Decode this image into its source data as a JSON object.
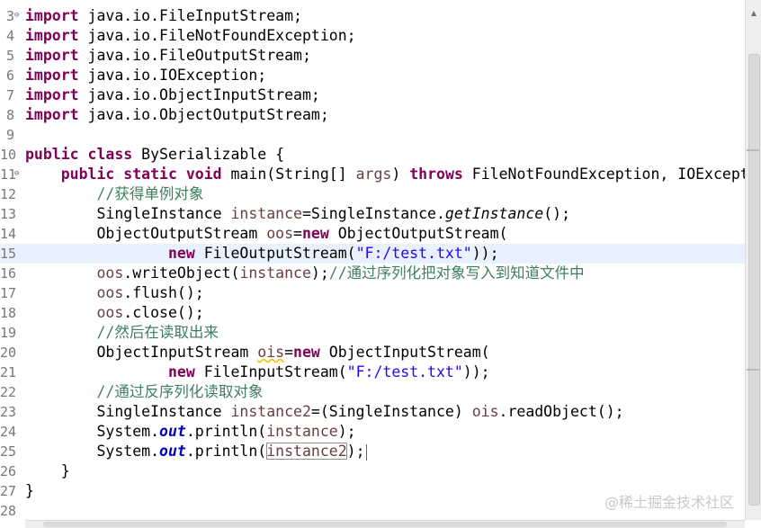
{
  "lines": [
    {
      "num": "3",
      "fold": "⊖",
      "current": false,
      "tokens": [
        {
          "t": "import",
          "c": "kw"
        },
        {
          "t": " java.io.FileInputStream;"
        }
      ]
    },
    {
      "num": "4",
      "fold": "",
      "current": false,
      "tokens": [
        {
          "t": "import",
          "c": "kw"
        },
        {
          "t": " java.io.FileNotFoundException;"
        }
      ]
    },
    {
      "num": "5",
      "fold": "",
      "current": false,
      "tokens": [
        {
          "t": "import",
          "c": "kw"
        },
        {
          "t": " java.io.FileOutputStream;"
        }
      ]
    },
    {
      "num": "6",
      "fold": "",
      "current": false,
      "tokens": [
        {
          "t": "import",
          "c": "kw"
        },
        {
          "t": " java.io.IOException;"
        }
      ]
    },
    {
      "num": "7",
      "fold": "",
      "current": false,
      "tokens": [
        {
          "t": "import",
          "c": "kw"
        },
        {
          "t": " java.io.ObjectInputStream;"
        }
      ]
    },
    {
      "num": "8",
      "fold": "",
      "current": false,
      "tokens": [
        {
          "t": "import",
          "c": "kw"
        },
        {
          "t": " java.io.ObjectOutputStream;"
        }
      ]
    },
    {
      "num": "9",
      "fold": "",
      "current": false,
      "tokens": []
    },
    {
      "num": "10",
      "fold": "",
      "current": false,
      "tokens": [
        {
          "t": "public",
          "c": "kw"
        },
        {
          "t": " "
        },
        {
          "t": "class",
          "c": "kw"
        },
        {
          "t": " BySerializable {"
        }
      ]
    },
    {
      "num": "11",
      "fold": "⊖",
      "current": false,
      "tokens": [
        {
          "t": "    "
        },
        {
          "t": "public",
          "c": "kw"
        },
        {
          "t": " "
        },
        {
          "t": "static",
          "c": "kw"
        },
        {
          "t": " "
        },
        {
          "t": "void",
          "c": "kw"
        },
        {
          "t": " main(String[] "
        },
        {
          "t": "args",
          "c": "arg"
        },
        {
          "t": ") "
        },
        {
          "t": "throws",
          "c": "kw"
        },
        {
          "t": " FileNotFoundException, IOException {"
        }
      ]
    },
    {
      "num": "12",
      "fold": "",
      "current": false,
      "tokens": [
        {
          "t": "        "
        },
        {
          "t": "//获得单例对象",
          "c": "cm"
        }
      ]
    },
    {
      "num": "13",
      "fold": "",
      "current": false,
      "tokens": [
        {
          "t": "        SingleInstance "
        },
        {
          "t": "instance",
          "c": "arg"
        },
        {
          "t": "=SingleInstance."
        },
        {
          "t": "getInstance",
          "c": "smeth"
        },
        {
          "t": "();"
        }
      ]
    },
    {
      "num": "14",
      "fold": "",
      "current": false,
      "tokens": [
        {
          "t": "        ObjectOutputStream "
        },
        {
          "t": "oos",
          "c": "arg"
        },
        {
          "t": "="
        },
        {
          "t": "new",
          "c": "kw"
        },
        {
          "t": " ObjectOutputStream("
        }
      ]
    },
    {
      "num": "15",
      "fold": "",
      "current": true,
      "tokens": [
        {
          "t": "                "
        },
        {
          "t": "new",
          "c": "kw"
        },
        {
          "t": " FileOutputStream("
        },
        {
          "t": "\"F:/test.txt\"",
          "c": "str"
        },
        {
          "t": "));"
        }
      ]
    },
    {
      "num": "16",
      "fold": "",
      "current": false,
      "tokens": [
        {
          "t": "        "
        },
        {
          "t": "oos",
          "c": "arg"
        },
        {
          "t": ".writeObject("
        },
        {
          "t": "instance",
          "c": "arg"
        },
        {
          "t": ");"
        },
        {
          "t": "//通过序列化把对象写入到知道文件中",
          "c": "cm"
        }
      ]
    },
    {
      "num": "17",
      "fold": "",
      "current": false,
      "tokens": [
        {
          "t": "        "
        },
        {
          "t": "oos",
          "c": "arg"
        },
        {
          "t": ".flush();"
        }
      ]
    },
    {
      "num": "18",
      "fold": "",
      "current": false,
      "tokens": [
        {
          "t": "        "
        },
        {
          "t": "oos",
          "c": "arg"
        },
        {
          "t": ".close();"
        }
      ]
    },
    {
      "num": "19",
      "fold": "",
      "current": false,
      "tokens": [
        {
          "t": "        "
        },
        {
          "t": "//然后在读取出来",
          "c": "cm"
        }
      ]
    },
    {
      "num": "20",
      "fold": "",
      "current": false,
      "tokens": [
        {
          "t": "        ObjectInputStream "
        },
        {
          "t": "ois",
          "c": "arg warn"
        },
        {
          "t": "="
        },
        {
          "t": "new",
          "c": "kw"
        },
        {
          "t": " ObjectInputStream("
        }
      ]
    },
    {
      "num": "21",
      "fold": "",
      "current": false,
      "tokens": [
        {
          "t": "                "
        },
        {
          "t": "new",
          "c": "kw"
        },
        {
          "t": " FileInputStream("
        },
        {
          "t": "\"F:/test.txt\"",
          "c": "str"
        },
        {
          "t": "));"
        }
      ]
    },
    {
      "num": "22",
      "fold": "",
      "current": false,
      "tokens": [
        {
          "t": "        "
        },
        {
          "t": "//通过反序列化读取对象",
          "c": "cm"
        }
      ]
    },
    {
      "num": "23",
      "fold": "",
      "current": false,
      "tokens": [
        {
          "t": "        SingleInstance "
        },
        {
          "t": "instance2",
          "c": "arg"
        },
        {
          "t": "=(SingleInstance) "
        },
        {
          "t": "ois",
          "c": "arg"
        },
        {
          "t": ".readObject();"
        }
      ]
    },
    {
      "num": "24",
      "fold": "",
      "current": false,
      "tokens": [
        {
          "t": "        System."
        },
        {
          "t": "out",
          "c": "sfld"
        },
        {
          "t": ".println("
        },
        {
          "t": "instance",
          "c": "arg"
        },
        {
          "t": ");"
        }
      ]
    },
    {
      "num": "25",
      "fold": "",
      "current": false,
      "tokens": [
        {
          "t": "        System."
        },
        {
          "t": "out",
          "c": "sfld"
        },
        {
          "t": ".println("
        },
        {
          "t": "instance2",
          "c": "arg boxed"
        },
        {
          "t": ");"
        }
      ],
      "caret": true
    },
    {
      "num": "26",
      "fold": "",
      "current": false,
      "tokens": [
        {
          "t": "    }"
        }
      ]
    },
    {
      "num": "27",
      "fold": "",
      "current": false,
      "tokens": [
        {
          "t": "}"
        }
      ]
    },
    {
      "num": "28",
      "fold": "",
      "current": false,
      "tokens": []
    }
  ],
  "watermark": "@稀土掘金技术社区",
  "scroll": {
    "up_arrow": "▲",
    "down_arrow": "▼"
  }
}
